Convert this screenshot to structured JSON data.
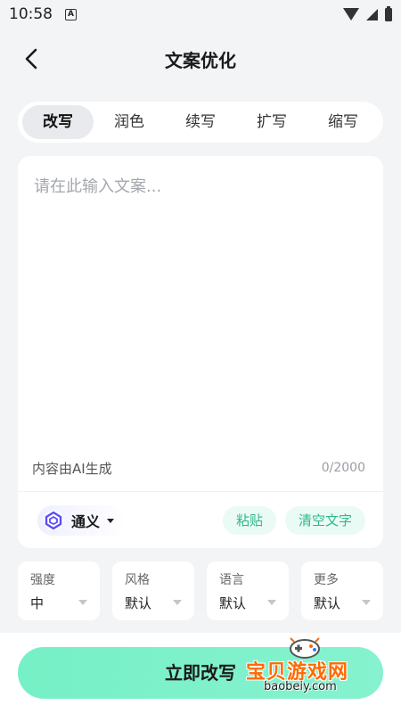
{
  "status_bar": {
    "time": "10:58",
    "indicator": "A"
  },
  "header": {
    "title": "文案优化",
    "back_icon": "chevron-left-icon"
  },
  "tabs": [
    {
      "label": "改写",
      "active": true
    },
    {
      "label": "润色",
      "active": false
    },
    {
      "label": "续写",
      "active": false
    },
    {
      "label": "扩写",
      "active": false
    },
    {
      "label": "缩写",
      "active": false
    }
  ],
  "editor": {
    "placeholder": "请在此输入文案...",
    "value": "",
    "ai_note": "内容由AI生成",
    "char_count": "0/2000"
  },
  "model": {
    "name": "通义",
    "icon": "tongyi-logo-icon"
  },
  "actions": {
    "paste_label": "粘贴",
    "clear_label": "清空文字"
  },
  "options": [
    {
      "label": "强度",
      "value": "中"
    },
    {
      "label": "风格",
      "value": "默认"
    },
    {
      "label": "语言",
      "value": "默认"
    },
    {
      "label": "更多",
      "value": "默认"
    }
  ],
  "primary_button": {
    "label": "立即改写"
  },
  "watermark": {
    "text": "宝贝游戏网",
    "domain": "baobeiy.com"
  },
  "colors": {
    "accent": "#76f0c6",
    "accent_text": "#2fb88a",
    "background": "#f3f4f6",
    "watermark": "#ff6a00"
  }
}
